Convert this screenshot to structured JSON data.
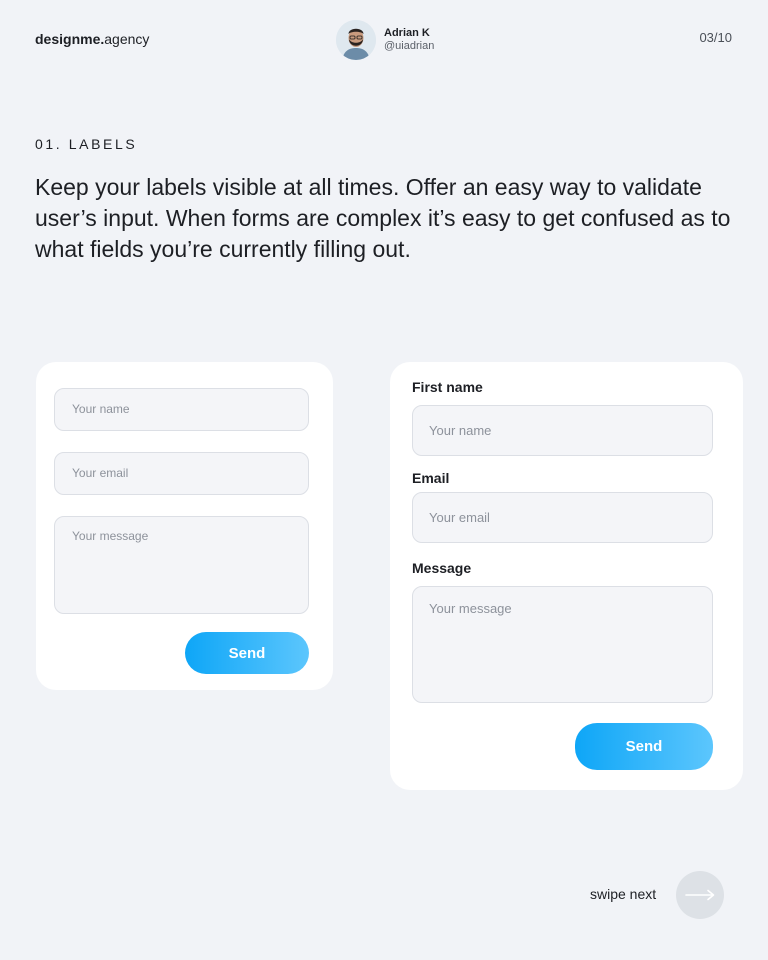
{
  "header": {
    "brand_bold": "designme.",
    "brand_light": "agency",
    "author_name": "Adrian K",
    "author_handle": "@uiadrian",
    "page_counter": "03/10"
  },
  "section": {
    "label": "01. LABELS",
    "lead": "Keep your labels visible at all times. Offer an easy way to validate user’s input. When forms are complex it’s easy to get confused as to what fields you’re currently filling out."
  },
  "form_left": {
    "name_placeholder": "Your name",
    "email_placeholder": "Your email",
    "message_placeholder": "Your message",
    "send_label": "Send"
  },
  "form_right": {
    "first_name_label": "First name",
    "name_placeholder": "Your name",
    "email_label": "Email",
    "email_placeholder": "Your email",
    "message_label": "Message",
    "message_placeholder": "Your message",
    "send_label": "Send"
  },
  "footer": {
    "swipe_text": "swipe next"
  },
  "colors": {
    "background": "#f1f3f7",
    "card": "#ffffff",
    "button_gradient_start": "#0ea6f7",
    "button_gradient_end": "#5cc6fd"
  },
  "icons": {
    "next": "arrow-right-icon"
  }
}
